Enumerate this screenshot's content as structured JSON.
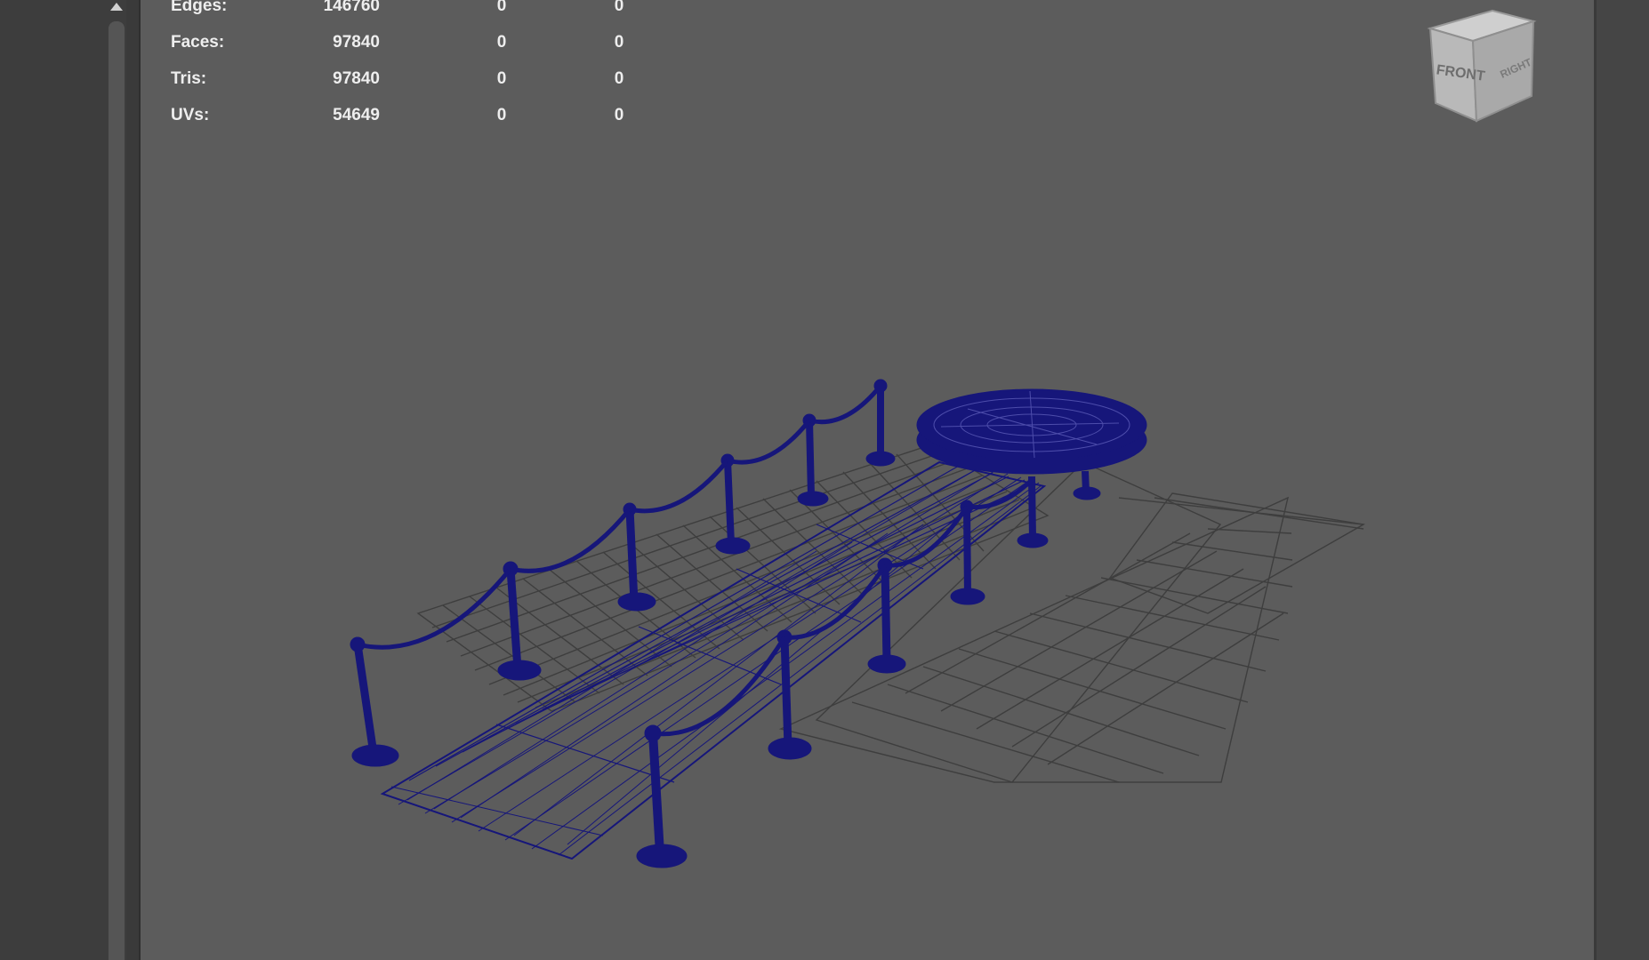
{
  "hud": {
    "rows": [
      {
        "label": "Edges:",
        "value": "146760",
        "selected": "0",
        "component": "0"
      },
      {
        "label": "Faces:",
        "value": "97840",
        "selected": "0",
        "component": "0"
      },
      {
        "label": "Tris:",
        "value": "97840",
        "selected": "0",
        "component": "0"
      },
      {
        "label": "UVs:",
        "value": "54649",
        "selected": "0",
        "component": "0"
      }
    ]
  },
  "viewcube": {
    "front_label": "FRONT",
    "right_label": "RIGHT"
  },
  "colors": {
    "wireframe": "#16167a",
    "grid": "#3c3c3c",
    "viewport_bg": "#5c5c5c"
  },
  "icons": {
    "scroll_up": "triangle-up-icon"
  }
}
